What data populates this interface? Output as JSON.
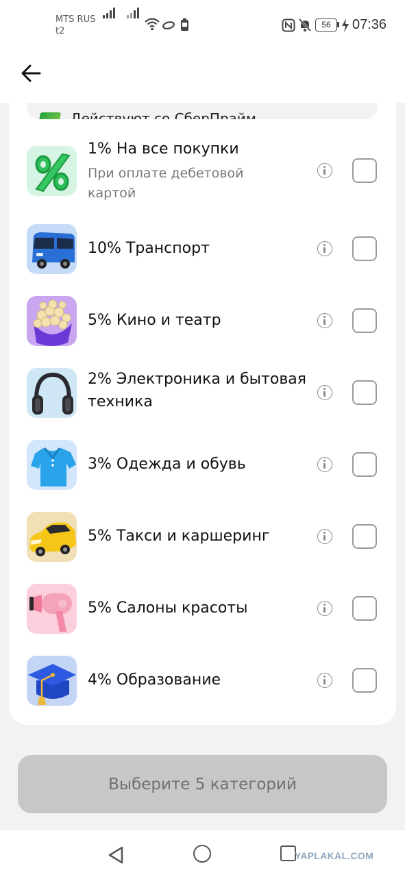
{
  "status_bar": {
    "carrier_line1": "MTS RUS",
    "carrier_line2": "t2",
    "battery": "56",
    "time": "07:36"
  },
  "header": {
    "back_icon": "arrow-left-icon"
  },
  "promo": {
    "text": "Действуют со СберПрайм"
  },
  "categories": [
    {
      "title": "1% На все покупки",
      "subtitle": "При оплате дебетовой картой",
      "icon": "percent-icon"
    },
    {
      "title": "10% Транспорт",
      "icon": "bus-icon"
    },
    {
      "title": "5% Кино и театр",
      "icon": "popcorn-icon"
    },
    {
      "title": "2% Электроника и бытовая техника",
      "icon": "headphones-icon"
    },
    {
      "title": "3% Одежда и обувь",
      "icon": "shirt-icon"
    },
    {
      "title": "5% Такси и каршеринг",
      "icon": "car-icon"
    },
    {
      "title": "5% Салоны красоты",
      "icon": "hairdryer-icon"
    },
    {
      "title": "4% Образование",
      "icon": "graduation-cap-icon"
    }
  ],
  "main_button": {
    "label": "Выберите 5 категорий"
  },
  "watermark": "YAPLAKAL.COM",
  "colors": {
    "accent_green": "#21a038",
    "button_disabled_bg": "#c7c7c9",
    "button_disabled_text": "#707072",
    "background": "#f2f2f4"
  }
}
